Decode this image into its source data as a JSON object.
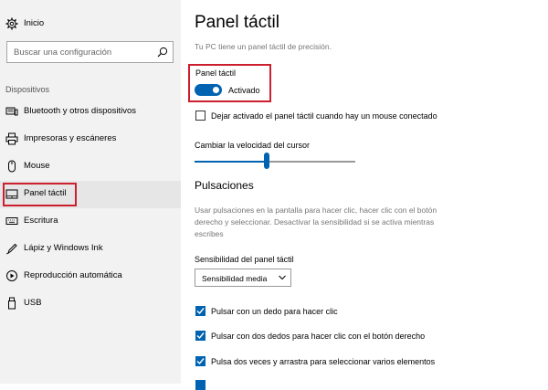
{
  "sidebar": {
    "home": {
      "label": "Inicio",
      "icon": "gear-icon"
    },
    "search": {
      "placeholder": "Buscar una configuración",
      "icon": "search-icon"
    },
    "section_label": "Dispositivos",
    "items": [
      {
        "label": "Bluetooth y otros dispositivos",
        "icon": "bluetooth-devices-icon"
      },
      {
        "label": "Impresoras y escáneres",
        "icon": "printer-icon"
      },
      {
        "label": "Mouse",
        "icon": "mouse-icon"
      },
      {
        "label": "Panel táctil",
        "icon": "touchpad-icon"
      },
      {
        "label": "Escritura",
        "icon": "keyboard-icon"
      },
      {
        "label": "Lápiz y Windows Ink",
        "icon": "pen-icon"
      },
      {
        "label": "Reproducción automática",
        "icon": "autoplay-icon"
      },
      {
        "label": "USB",
        "icon": "usb-icon"
      }
    ]
  },
  "main": {
    "title": "Panel táctil",
    "subtitle": "Tu PC tiene un panel táctil de precisión.",
    "toggle": {
      "label": "Panel táctil",
      "state_label": "Activado",
      "on": true
    },
    "leave_on_checkbox": {
      "label": "Dejar activado el panel táctil cuando hay un mouse conectado",
      "checked": false
    },
    "cursor_speed": {
      "label": "Cambiar la velocidad del cursor",
      "value_fraction": 0.45
    },
    "taps": {
      "heading": "Pulsaciones",
      "description": "Usar pulsaciones en la pantalla para hacer clic, hacer clic con el botón derecho y seleccionar. Desactivar la sensibilidad si se activa mientras escribes",
      "sensitivity_label": "Sensibilidad del panel táctil",
      "sensitivity_value": "Sensibilidad media",
      "options": [
        {
          "label": "Pulsar con un dedo para hacer clic",
          "checked": true
        },
        {
          "label": "Pulsar con dos dedos para hacer clic con el botón derecho",
          "checked": true
        },
        {
          "label": "Pulsa dos veces y arrastra para seleccionar varios elementos",
          "checked": true
        }
      ]
    }
  },
  "colors": {
    "accent": "#0063b1",
    "highlight": "#cc1f2e",
    "sidebar_bg": "#f2f2f2"
  }
}
